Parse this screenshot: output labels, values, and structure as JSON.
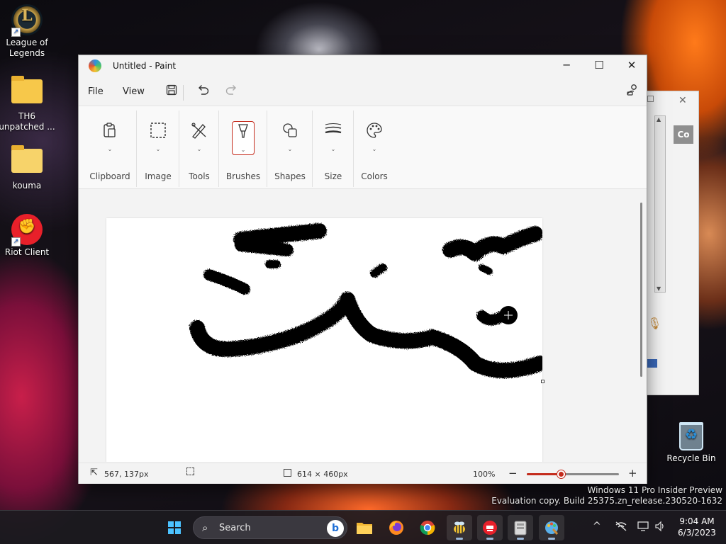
{
  "desktop": {
    "icons": [
      {
        "label": "League of Legends",
        "icon": "league-of-legends-icon"
      },
      {
        "label": "TH6 unpatched ...",
        "icon": "folder-icon"
      },
      {
        "label": "kouma",
        "icon": "folder-icon"
      },
      {
        "label": "Riot Client",
        "icon": "riot-client-icon"
      },
      {
        "label": "Recycle Bin",
        "icon": "recycle-bin-icon"
      }
    ],
    "watermark": {
      "line1": "Windows 11 Pro Insider Preview",
      "line2": "Evaluation copy. Build 25375.zn_release.230520-1632"
    }
  },
  "bg_window": {
    "badge": "Co"
  },
  "paint": {
    "title": "Untitled - Paint",
    "window_controls": {
      "minimize": "─",
      "maximize": "☐",
      "close": "✕"
    },
    "menu": {
      "file": "File",
      "view": "View"
    },
    "quick": {
      "save_icon": "save-icon",
      "undo_icon": "undo-icon",
      "redo_icon": "redo-icon",
      "settings_icon": "settings-icon"
    },
    "ribbon": {
      "groups": [
        {
          "label": "Clipboard",
          "icon": "clipboard-icon"
        },
        {
          "label": "Image",
          "icon": "selection-icon"
        },
        {
          "label": "Tools",
          "icon": "tools-icon"
        },
        {
          "label": "Brushes",
          "icon": "brush-icon",
          "selected": true
        },
        {
          "label": "Shapes",
          "icon": "shapes-icon"
        },
        {
          "label": "Size",
          "icon": "size-icon"
        },
        {
          "label": "Colors",
          "icon": "colors-icon"
        }
      ]
    },
    "status": {
      "cursor_position": "567, 137px",
      "canvas_size": "614 × 460px",
      "zoom": "100%",
      "zoom_out": "−",
      "zoom_in": "+",
      "zoom_slider_fraction": 0.38
    }
  },
  "taskbar": {
    "search_label": "Search",
    "apps": [
      "file-explorer-icon",
      "firefox-icon",
      "chrome-icon",
      "bee-app-icon",
      "riot-client-icon",
      "archive-app-icon",
      "paint-icon"
    ],
    "tray": {
      "chevron": "^"
    },
    "clock": {
      "time": "9:04 AM",
      "date": "6/3/2023"
    }
  }
}
